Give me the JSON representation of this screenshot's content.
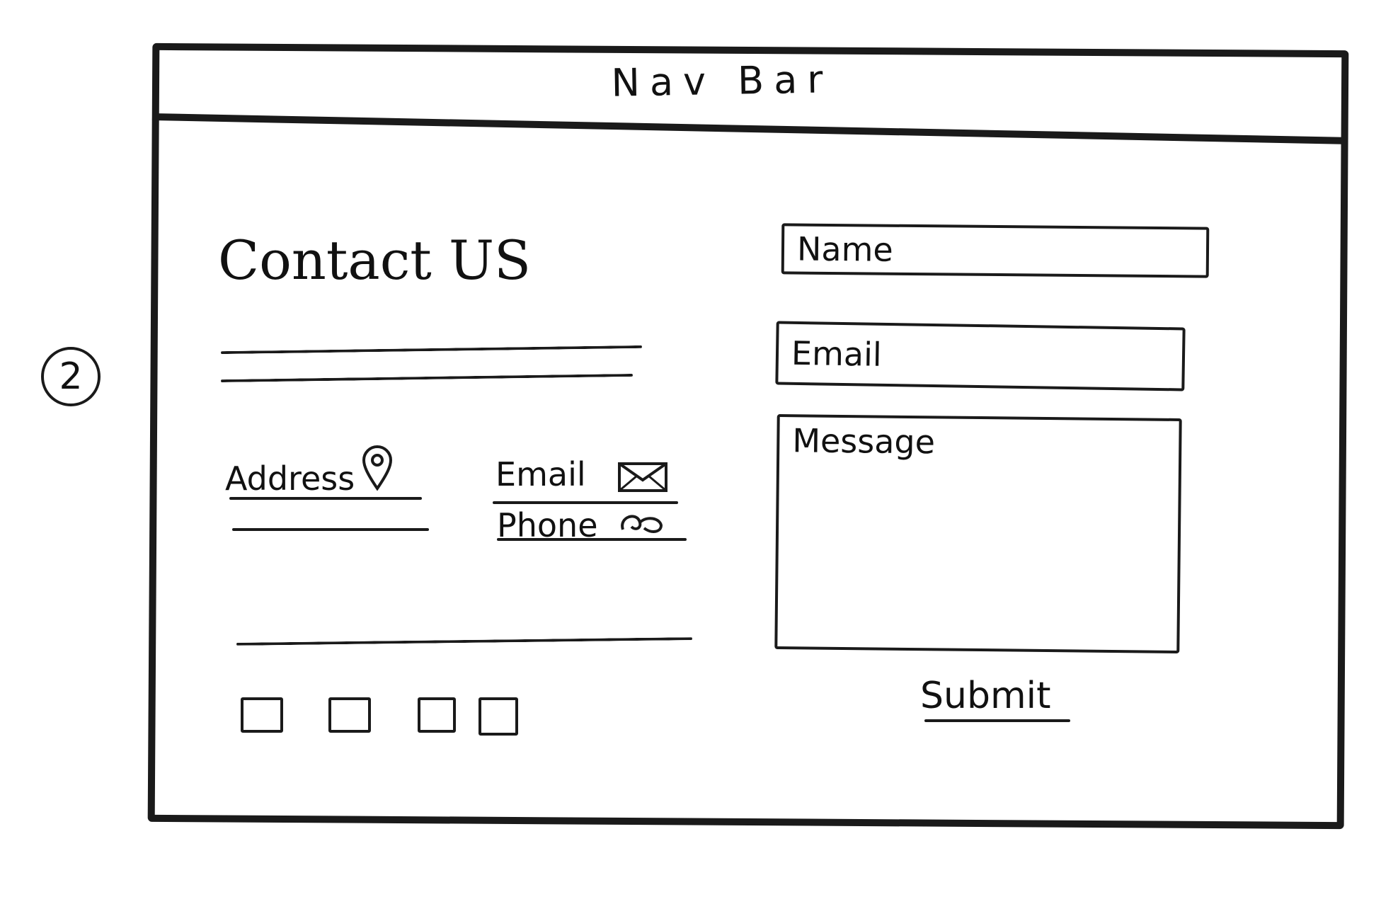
{
  "side_note": {
    "page_number": "2"
  },
  "navbar": {
    "title": "Nav Bar"
  },
  "contact": {
    "heading": "Contact US",
    "address_label": "Address",
    "email_label": "Email",
    "phone_label": "Phone"
  },
  "form": {
    "name_placeholder": "Name",
    "email_placeholder": "Email",
    "message_placeholder": "Message",
    "submit_label": "Submit"
  },
  "social": {
    "buttons": [
      "social-link-1",
      "social-link-2",
      "social-link-3",
      "social-link-4"
    ]
  },
  "icons": {
    "address": "map-pin-icon",
    "email": "envelope-icon",
    "phone": "phone-icon"
  }
}
